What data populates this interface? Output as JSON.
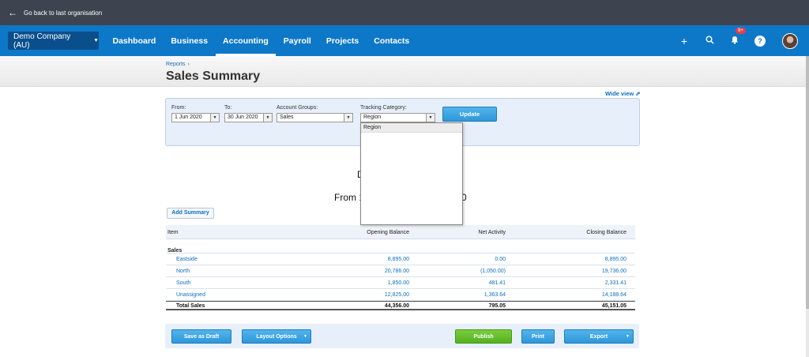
{
  "topbar": {
    "back_label": "Go back to last organisation"
  },
  "navbar": {
    "org_label": "Demo Company (AU)",
    "items": [
      {
        "label": "Dashboard"
      },
      {
        "label": "Business"
      },
      {
        "label": "Accounting"
      },
      {
        "label": "Payroll"
      },
      {
        "label": "Projects"
      },
      {
        "label": "Contacts"
      }
    ],
    "active_item": "Accounting",
    "notification_count": "9+",
    "icons": [
      "plus-icon",
      "search-icon",
      "bell-icon",
      "help-icon",
      "avatar"
    ]
  },
  "header": {
    "breadcrumb": "Reports",
    "title": "Sales Summary",
    "wide_view": "Wide view"
  },
  "filters": {
    "from_label": "From:",
    "from_value": "1 Jun 2020",
    "to_label": "To:",
    "to_value": "30 Jun 2020",
    "account_groups_label": "Account Groups:",
    "account_groups_value": "Sales",
    "tracking_label": "Tracking Category:",
    "tracking_value": "Region",
    "update_label": "Update",
    "dropdown_options": [
      "Region"
    ]
  },
  "report": {
    "title_line1_fragment": "D",
    "title_line2_start": "From 1",
    "title_line2_end": "0",
    "add_summary": "Add Summary"
  },
  "table": {
    "headers": [
      "Item",
      "Opening Balance",
      "Net Activity",
      "Closing Balance"
    ],
    "section": "Sales",
    "rows": [
      {
        "item": "Eastside",
        "opening": "8,895.00",
        "net": "0.00",
        "closing": "8,895.00"
      },
      {
        "item": "North",
        "opening": "20,786.00",
        "net": "(1,050.00)",
        "closing": "19,736.00"
      },
      {
        "item": "South",
        "opening": "1,850.00",
        "net": "481.41",
        "closing": "2,331.41"
      },
      {
        "item": "Unassigned",
        "opening": "12,825.00",
        "net": "1,363.64",
        "closing": "14,188.64"
      }
    ],
    "total": {
      "item": "Total Sales",
      "opening": "44,356.00",
      "net": "795.05",
      "closing": "45,151.05"
    }
  },
  "actions": {
    "save_draft": "Save as Draft",
    "layout_options": "Layout Options",
    "publish": "Publish",
    "print": "Print",
    "export": "Export"
  },
  "colors": {
    "navbar": "#0d78c8",
    "topbar": "#3d4450",
    "link": "#0d6fbf",
    "publish": "#55b020"
  }
}
